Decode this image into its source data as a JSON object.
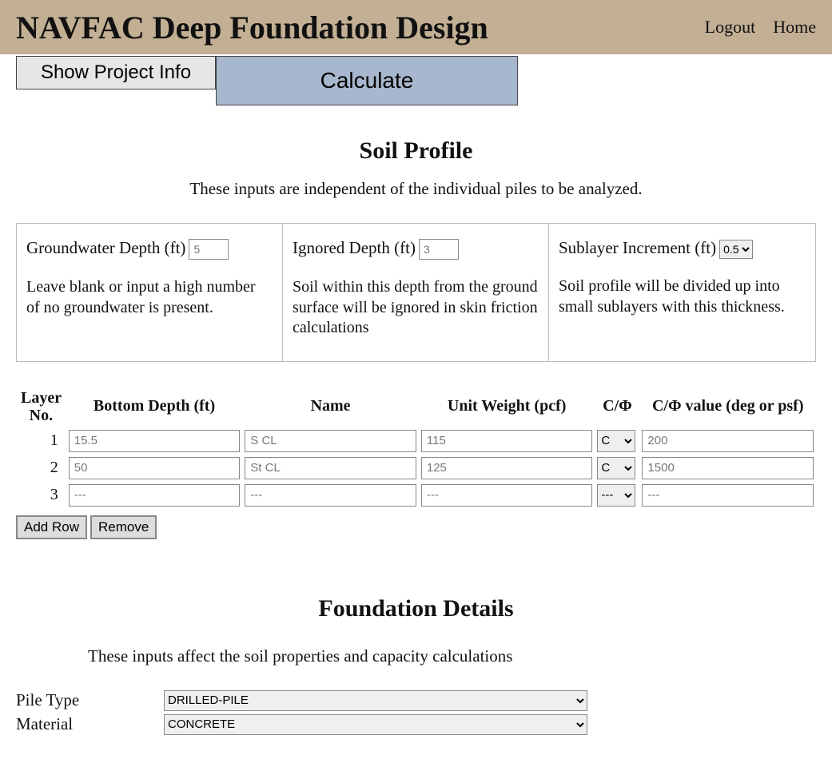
{
  "header": {
    "title": "NAVFAC Deep Foundation Design",
    "nav": {
      "logout": "Logout",
      "home": "Home"
    }
  },
  "toolbar": {
    "show_project_info": "Show Project Info",
    "calculate": "Calculate"
  },
  "soil_profile": {
    "title": "Soil Profile",
    "subtitle": "These inputs are independent of the individual piles to be analyzed.",
    "groundwater": {
      "label": "Groundwater Depth (ft)",
      "value": "5",
      "desc": "Leave blank or input a high number of no groundwater is present."
    },
    "ignored": {
      "label": "Ignored Depth (ft)",
      "value": "3",
      "desc": "Soil within this depth from the ground surface will be ignored in skin friction calculations"
    },
    "sublayer": {
      "label": "Sublayer Increment (ft)",
      "value": "0.5",
      "desc": "Soil profile will be divided up into small sublayers with this thickness."
    }
  },
  "layers": {
    "headers": {
      "no": "Layer No.",
      "depth": "Bottom Depth (ft)",
      "name": "Name",
      "weight": "Unit Weight (pcf)",
      "cphi": "C/Φ",
      "cphi_val": "C/Φ value (deg or psf)"
    },
    "rows": [
      {
        "no": "1",
        "depth": "15.5",
        "name": "S CL",
        "weight": "115",
        "cphi": "C",
        "cphi_val": "200"
      },
      {
        "no": "2",
        "depth": "50",
        "name": "St CL",
        "weight": "125",
        "cphi": "C",
        "cphi_val": "1500"
      },
      {
        "no": "3",
        "depth": "---",
        "name": "---",
        "weight": "---",
        "cphi": "---",
        "cphi_val": "---"
      }
    ],
    "add_row": "Add Row",
    "remove": "Remove"
  },
  "foundation": {
    "title": "Foundation Details",
    "subtitle": "These inputs affect the soil properties and capacity calculations",
    "pile_type_label": "Pile Type",
    "pile_type_value": "DRILLED-PILE",
    "material_label": "Material",
    "material_value": "CONCRETE"
  }
}
